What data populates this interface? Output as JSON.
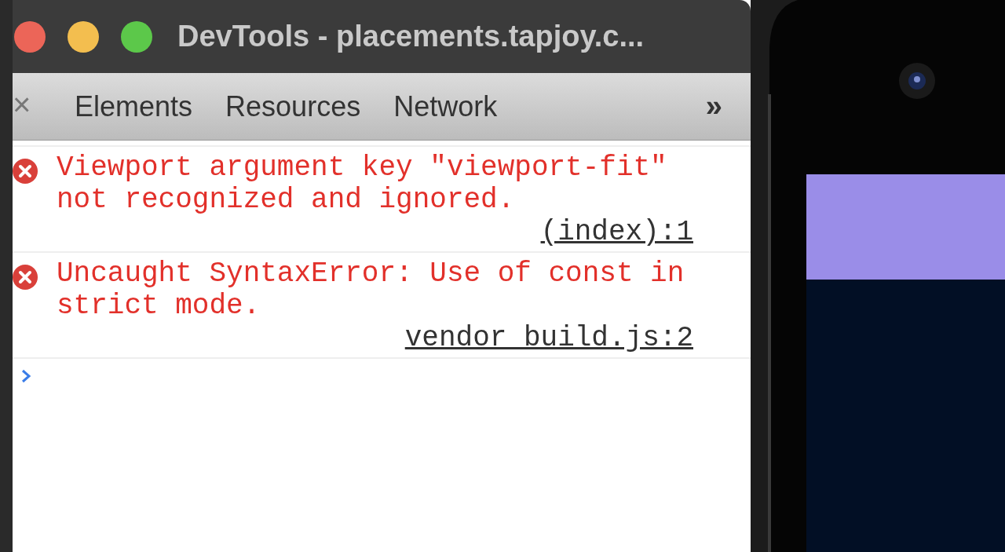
{
  "window": {
    "title": "DevTools - placements.tapjoy.c..."
  },
  "toolbar": {
    "close": "×",
    "tabs": [
      {
        "label": "Elements"
      },
      {
        "label": "Resources"
      },
      {
        "label": "Network"
      }
    ],
    "more": "»"
  },
  "console": {
    "messages": [
      {
        "kind": "error",
        "text": "Viewport argument key \"viewport-fit\" not recognized and ignored.",
        "source": "(index):1"
      },
      {
        "kind": "error",
        "text": "Uncaught SyntaxError: Use of const in strict mode.",
        "source": "vendor_build.js:2"
      }
    ]
  }
}
